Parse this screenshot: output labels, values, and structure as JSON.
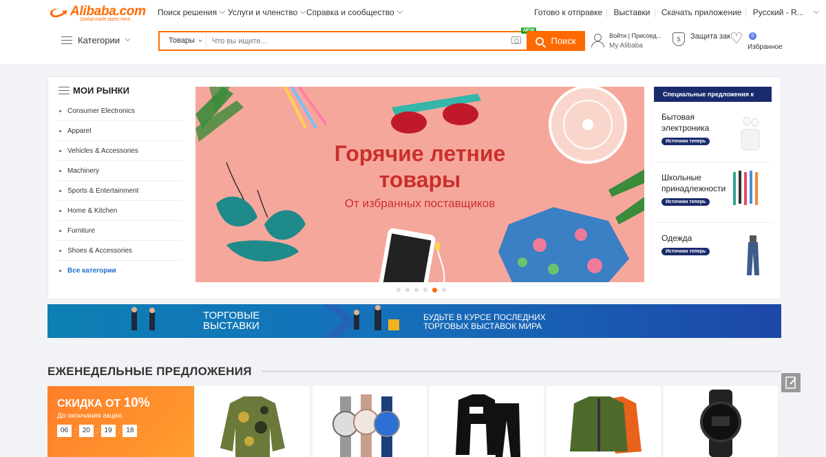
{
  "header": {
    "logo_text": "Alibaba.com",
    "logo_sub": "Global trade starts here.",
    "nav": [
      "Поиск решения",
      "Услуги и членство",
      "Справка и сообщество"
    ],
    "links": [
      "Готово к отправке",
      "Выставки",
      "Скачать приложение",
      "Русский - R..."
    ],
    "categories_label": "Категории",
    "search": {
      "category": "Товары",
      "placeholder": "Что вы ищите...",
      "new_badge": "NEW",
      "button_label": "Поиск"
    },
    "user": {
      "line1": "Войти | Присоед...",
      "line2": "My Alibaba"
    },
    "protection_label": "Защита зак",
    "favorites_label": "Избранное",
    "favorites_count": "0"
  },
  "markets": {
    "title": "МОИ РЫНКИ",
    "items": [
      "Consumer Electronics",
      "Apparel",
      "Vehicles & Accessories",
      "Machinery",
      "Sports & Entertainment",
      "Home & Kitchen",
      "Furniture",
      "Shoes & Accessories"
    ],
    "all_label": "Все категории"
  },
  "banner": {
    "title_line1": "Горячие летние",
    "title_line2": "товары",
    "subtitle": "От избранных поставщиков",
    "slides": 6,
    "active_slide": 5
  },
  "specials": {
    "header": "Специальные предложения к",
    "items": [
      {
        "name": "Бытовая электроника",
        "button": "Источник теперь"
      },
      {
        "name": "Школьные принадлежности",
        "button": "Источник теперь"
      },
      {
        "name": "Одежда",
        "button": "Источник теперь"
      }
    ]
  },
  "trade_banner": {
    "left_line1": "ТОРГОВЫЕ",
    "left_line2": "ВЫСТАВКИ",
    "right_line1": "БУДЬТЕ В КУРСЕ ПОСЛЕДНИХ",
    "right_line2": "ТОРГОВЫХ ВЫСТАВОК МИРА"
  },
  "weekly": {
    "title": "ЕЖЕНЕДЕЛЬНЫЕ ПРЕДЛОЖЕНИЯ",
    "discount_prefix": "СКИДКА ОТ",
    "discount_value": "10%",
    "countdown_label": "До окончания акции:",
    "countdown": [
      "06",
      "20",
      "19",
      "18"
    ],
    "products": [
      "camo-jacket",
      "watches",
      "tracksuit",
      "bomber-jacket",
      "digital-watch"
    ]
  },
  "colors": {
    "brand": "#ff6a00",
    "navy": "#1a2b6d",
    "banner_bg": "#f6a79c",
    "banner_text": "#c9302c"
  }
}
